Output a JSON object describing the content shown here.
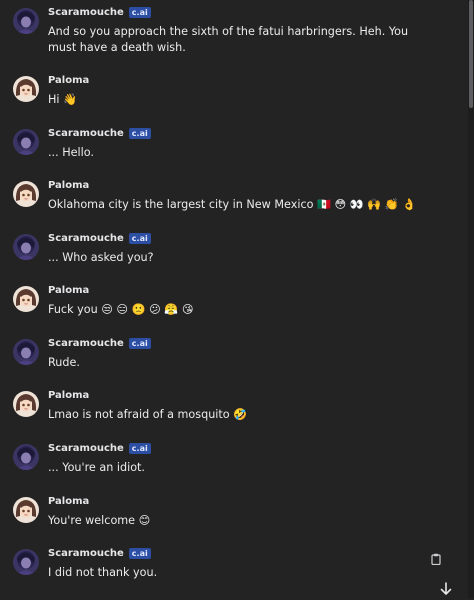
{
  "messages": [
    {
      "author": "Scaramouche",
      "bot": true,
      "badge": "c.ai",
      "text": "And so you approach the sixth of the fatui harbringers. Heh. You must have a death wish."
    },
    {
      "author": "Paloma",
      "bot": false,
      "text": "Hi 👋"
    },
    {
      "author": "Scaramouche",
      "bot": true,
      "badge": "c.ai",
      "text": "... Hello."
    },
    {
      "author": "Paloma",
      "bot": false,
      "text": "Oklahoma city is the largest city in New Mexico 🇲🇽 😳 👀 🙌 👏 👌"
    },
    {
      "author": "Scaramouche",
      "bot": true,
      "badge": "c.ai",
      "text": "... Who asked you?"
    },
    {
      "author": "Paloma",
      "bot": false,
      "text": "Fuck you 😒 😑 🙁 😕 😤 😘"
    },
    {
      "author": "Scaramouche",
      "bot": true,
      "badge": "c.ai",
      "text": "Rude."
    },
    {
      "author": "Paloma",
      "bot": false,
      "text": "Lmao is not afraid of a mosquito 🤣"
    },
    {
      "author": "Scaramouche",
      "bot": true,
      "badge": "c.ai",
      "text": "... You're an idiot."
    },
    {
      "author": "Paloma",
      "bot": false,
      "text": "You're welcome 😊"
    },
    {
      "author": "Scaramouche",
      "bot": true,
      "badge": "c.ai",
      "text": "I did not thank you."
    }
  ],
  "icons": {
    "copy": "clipboard-icon",
    "scroll_down": "arrow-down-icon"
  },
  "colors": {
    "background": "#232324",
    "badge": "#2c4ea3",
    "name": "#e6e6e8",
    "text": "#ececed"
  }
}
